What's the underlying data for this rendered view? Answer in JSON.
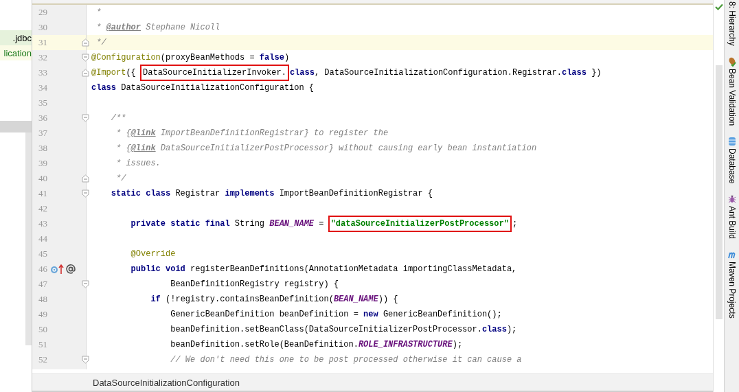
{
  "project_tree": {
    "rows": [
      {
        "label": ".jdbc",
        "selected": true
      },
      {
        "label": "lication",
        "selected": false
      }
    ]
  },
  "editor": {
    "lines": [
      {
        "number": "29",
        "tokens": [
          {
            "kind": "comment",
            "text": " *"
          }
        ]
      },
      {
        "number": "30",
        "tokens": [
          {
            "kind": "comment",
            "text": " * "
          },
          {
            "kind": "doctag",
            "text": "@author"
          },
          {
            "kind": "comment",
            "text": " Stephane Nicoll"
          }
        ]
      },
      {
        "number": "31",
        "current": true,
        "fold": {
          "kind": "close"
        },
        "tokens": [
          {
            "kind": "comment",
            "text": " */"
          }
        ]
      },
      {
        "number": "32",
        "fold": {
          "kind": "open"
        },
        "tokens": [
          {
            "kind": "annotation",
            "text": "@Configuration"
          },
          {
            "kind": "plain",
            "text": "(proxyBeanMethods = "
          },
          {
            "kind": "keyword",
            "text": "false"
          },
          {
            "kind": "plain",
            "text": ")"
          }
        ]
      },
      {
        "number": "33",
        "fold": {
          "kind": "close"
        },
        "tokens": [
          {
            "kind": "annotation",
            "text": "@Import"
          },
          {
            "kind": "plain",
            "text": "({ "
          },
          {
            "kind": "plain",
            "text": "DataSourceInitializerInvoker.",
            "boxed": true
          },
          {
            "kind": "keyword",
            "text": "class"
          },
          {
            "kind": "plain",
            "text": ", DataSourceInitializationConfiguration.Registrar."
          },
          {
            "kind": "keyword",
            "text": "class"
          },
          {
            "kind": "plain",
            "text": " })"
          }
        ]
      },
      {
        "number": "34",
        "tokens": [
          {
            "kind": "keyword",
            "text": "class"
          },
          {
            "kind": "plain",
            "text": " DataSourceInitializationConfiguration {"
          }
        ]
      },
      {
        "number": "35"
      },
      {
        "number": "36",
        "fold": {
          "kind": "open"
        },
        "tokens": [
          {
            "kind": "comment",
            "text": "    /**"
          }
        ]
      },
      {
        "number": "37",
        "tokens": [
          {
            "kind": "comment",
            "text": "     * {"
          },
          {
            "kind": "doctag",
            "text": "@link"
          },
          {
            "kind": "comment",
            "text": " ImportBeanDefinitionRegistrar} to register the"
          }
        ]
      },
      {
        "number": "38",
        "tokens": [
          {
            "kind": "comment",
            "text": "     * {"
          },
          {
            "kind": "doctag",
            "text": "@link"
          },
          {
            "kind": "comment",
            "text": " DataSourceInitializerPostProcessor} without causing early bean instantiation"
          }
        ]
      },
      {
        "number": "39",
        "tokens": [
          {
            "kind": "comment",
            "text": "     * issues."
          }
        ]
      },
      {
        "number": "40",
        "fold": {
          "kind": "close"
        },
        "tokens": [
          {
            "kind": "comment",
            "text": "     */"
          }
        ]
      },
      {
        "number": "41",
        "fold": {
          "kind": "open"
        },
        "tokens": [
          {
            "kind": "keyword",
            "text": "    static class"
          },
          {
            "kind": "plain",
            "text": " Registrar "
          },
          {
            "kind": "keyword",
            "text": "implements"
          },
          {
            "kind": "plain",
            "text": " ImportBeanDefinitionRegistrar {"
          }
        ]
      },
      {
        "number": "42"
      },
      {
        "number": "43",
        "tokens": [
          {
            "kind": "keyword",
            "text": "        private static final"
          },
          {
            "kind": "plain",
            "text": " String "
          },
          {
            "kind": "constant",
            "text": "BEAN_NAME"
          },
          {
            "kind": "plain",
            "text": " = "
          },
          {
            "kind": "string",
            "text": "\"dataSourceInitializerPostProcessor\"",
            "boxed": true
          },
          {
            "kind": "plain",
            "text": ";"
          }
        ]
      },
      {
        "number": "44"
      },
      {
        "number": "45",
        "tokens": [
          {
            "kind": "annotation",
            "text": "        @Override"
          }
        ]
      },
      {
        "number": "46",
        "gutter": [
          {
            "kind": "overrides"
          },
          {
            "kind": "annotated"
          }
        ],
        "tokens": [
          {
            "kind": "keyword",
            "text": "        public void"
          },
          {
            "kind": "plain",
            "text": " registerBeanDefinitions(AnnotationMetadata importingClassMetadata,"
          }
        ]
      },
      {
        "number": "47",
        "fold": {
          "kind": "open"
        },
        "tokens": [
          {
            "kind": "plain",
            "text": "                BeanDefinitionRegistry registry) {"
          }
        ]
      },
      {
        "number": "48",
        "tokens": [
          {
            "kind": "keyword",
            "text": "            if"
          },
          {
            "kind": "plain",
            "text": " (!registry.containsBeanDefinition("
          },
          {
            "kind": "constant",
            "text": "BEAN_NAME"
          },
          {
            "kind": "plain",
            "text": ")) {"
          }
        ]
      },
      {
        "number": "49",
        "tokens": [
          {
            "kind": "plain",
            "text": "                GenericBeanDefinition beanDefinition = "
          },
          {
            "kind": "keyword",
            "text": "new"
          },
          {
            "kind": "plain",
            "text": " GenericBeanDefinition();"
          }
        ]
      },
      {
        "number": "50",
        "tokens": [
          {
            "kind": "plain",
            "text": "                beanDefinition.setBeanClass(DataSourceInitializerPostProcessor."
          },
          {
            "kind": "keyword",
            "text": "class"
          },
          {
            "kind": "plain",
            "text": ");"
          }
        ]
      },
      {
        "number": "51",
        "tokens": [
          {
            "kind": "plain",
            "text": "                beanDefinition.setRole(BeanDefinition."
          },
          {
            "kind": "constant",
            "text": "ROLE_INFRASTRUCTURE"
          },
          {
            "kind": "plain",
            "text": ");"
          }
        ]
      },
      {
        "number": "52",
        "fold": {
          "kind": "open"
        },
        "tokens": [
          {
            "kind": "comment",
            "text": "                // We don't need this one to be post processed otherwise it can cause a"
          }
        ]
      }
    ]
  },
  "breadcrumb": "DataSourceInitializationConfiguration",
  "tool_windows": [
    {
      "kind": "hierarchy",
      "label": "8: Hierarchy"
    },
    {
      "kind": "bean",
      "label": "Bean Validation"
    },
    {
      "kind": "database",
      "label": "Database"
    },
    {
      "kind": "ant",
      "label": "Ant Build"
    },
    {
      "kind": "maven",
      "label": "Maven Projects"
    }
  ]
}
